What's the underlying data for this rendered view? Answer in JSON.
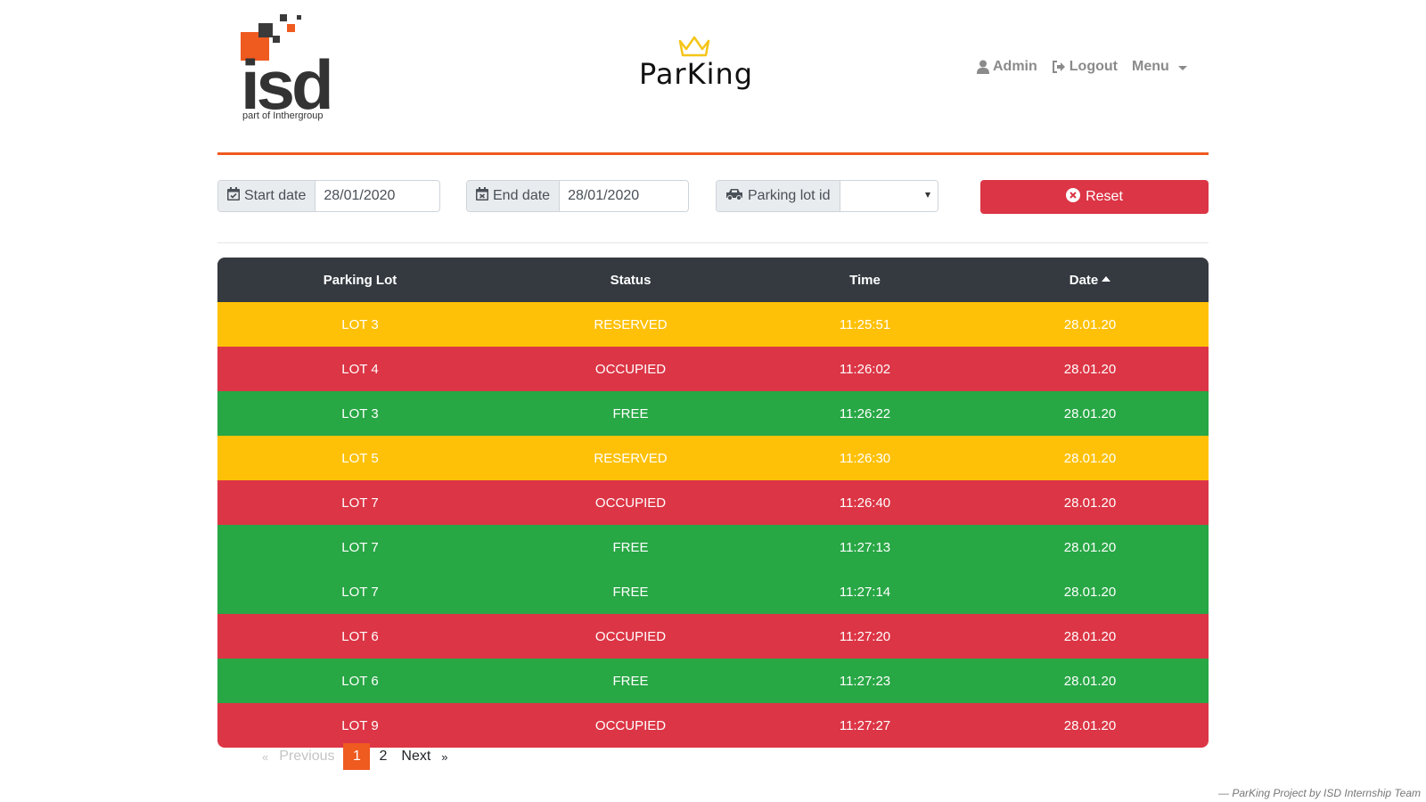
{
  "header": {
    "logo": {
      "text": "isd",
      "subtitle": "part of Inthergroup"
    },
    "brand": "ParKing",
    "nav": [
      {
        "label": "Admin",
        "icon": "user-icon"
      },
      {
        "label": "Logout",
        "icon": "logout-icon"
      },
      {
        "label": "Menu",
        "icon": "chevron-down-icon"
      }
    ]
  },
  "filters": {
    "start_date": {
      "label": "Start date",
      "value": "28/01/2020",
      "icon": "calendar-icon"
    },
    "end_date": {
      "label": "End date",
      "value": "28/01/2020",
      "icon": "calendar-icon"
    },
    "parking_lot": {
      "label": "Parking lot id",
      "value": "",
      "icon": "car-icon"
    },
    "reset": {
      "label": "Reset",
      "icon": "close-circle-icon"
    }
  },
  "table": {
    "columns": [
      "Parking Lot",
      "Status",
      "Time",
      "Date"
    ],
    "sort_column": "Date",
    "rows": [
      {
        "lot": "LOT 3",
        "status": "RESERVED",
        "time": "11:25:51",
        "date": "28.01.20"
      },
      {
        "lot": "LOT 4",
        "status": "OCCUPIED",
        "time": "11:26:02",
        "date": "28.01.20"
      },
      {
        "lot": "LOT 3",
        "status": "FREE",
        "time": "11:26:22",
        "date": "28.01.20"
      },
      {
        "lot": "LOT 5",
        "status": "RESERVED",
        "time": "11:26:30",
        "date": "28.01.20"
      },
      {
        "lot": "LOT 7",
        "status": "OCCUPIED",
        "time": "11:26:40",
        "date": "28.01.20"
      },
      {
        "lot": "LOT 7",
        "status": "FREE",
        "time": "11:27:13",
        "date": "28.01.20"
      },
      {
        "lot": "LOT 7",
        "status": "FREE",
        "time": "11:27:14",
        "date": "28.01.20"
      },
      {
        "lot": "LOT 6",
        "status": "OCCUPIED",
        "time": "11:27:20",
        "date": "28.01.20"
      },
      {
        "lot": "LOT 6",
        "status": "FREE",
        "time": "11:27:23",
        "date": "28.01.20"
      },
      {
        "lot": "LOT 9",
        "status": "OCCUPIED",
        "time": "11:27:27",
        "date": "28.01.20"
      }
    ]
  },
  "pagination": {
    "prev_symbol": "«",
    "prev": "Previous",
    "pages": [
      "1",
      "2"
    ],
    "current": "1",
    "next": "Next",
    "next_symbol": "»"
  },
  "footer": "— ParKing Project by ISD Internship Team",
  "colors": {
    "accent": "#ef5a1f",
    "reserved": "#ffc107",
    "occupied": "#dc3545",
    "free": "#28a745",
    "header_dark": "#343a40"
  }
}
